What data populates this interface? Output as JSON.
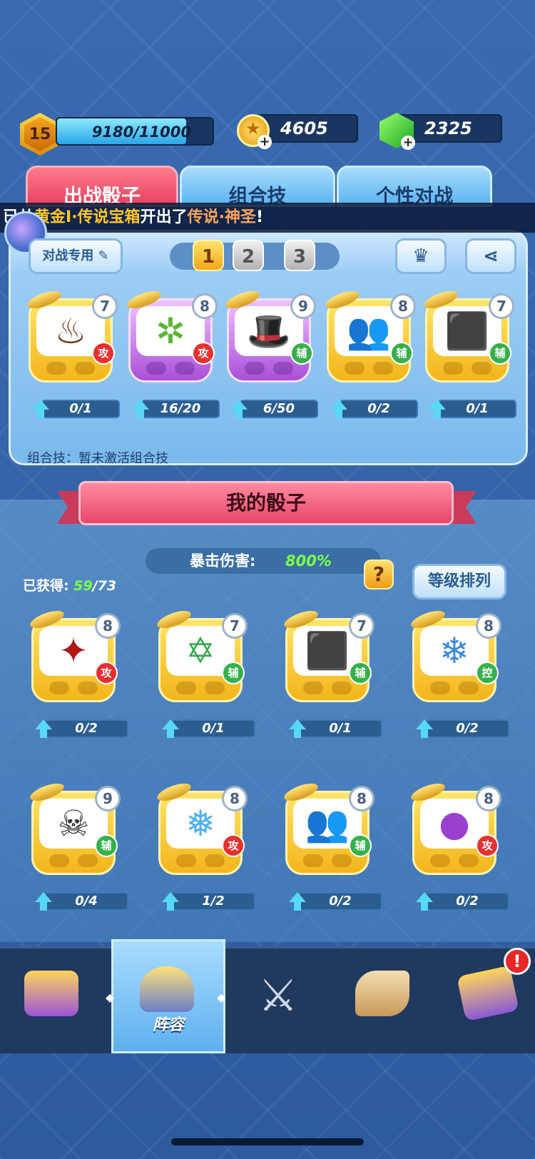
{
  "header": {
    "level": "15",
    "xp": "9180/11000",
    "xp_fraction": 0.83,
    "coins": "4605",
    "gems": "2325"
  },
  "tabs": [
    {
      "label": "出战骰子",
      "active": true
    },
    {
      "label": "组合技",
      "active": false
    },
    {
      "label": "个性对战",
      "active": false
    }
  ],
  "ticker": {
    "part1": "已从",
    "part2": "黄金I·传说宝箱",
    "part3": "开出了",
    "part4": "传说·神圣",
    "part5": "!"
  },
  "deck": {
    "name_label": "对战专用",
    "pages": [
      "1",
      "2",
      "3"
    ],
    "active_page": "1",
    "dice": [
      {
        "level": "7",
        "role": "攻",
        "progress": "0/1",
        "icon": "spiky-hair-icon",
        "style": "gold"
      },
      {
        "level": "8",
        "role": "攻",
        "progress": "16/20",
        "icon": "thorn-bush-icon",
        "style": "purple"
      },
      {
        "level": "9",
        "role": "辅",
        "progress": "6/50",
        "icon": "magic-hat-icon",
        "style": "purple"
      },
      {
        "level": "8",
        "role": "辅",
        "progress": "0/2",
        "icon": "twin-silhouette-icon",
        "style": "gold"
      },
      {
        "level": "7",
        "role": "辅",
        "progress": "0/1",
        "icon": "red-cylinder-icon",
        "style": "gold"
      }
    ],
    "combo_text": "组合技：暂未激活组合技"
  },
  "my_dice": {
    "title": "我的骰子",
    "obtained_label": "已获得:",
    "obtained_count": "59",
    "obtained_total": "/73",
    "crit_label": "暴击伤害:",
    "crit_value": "800%",
    "help_label": "?",
    "sort_label": "等级排列",
    "dice": [
      {
        "level": "8",
        "role": "攻",
        "progress": "0/2",
        "icon": "bloody-shuriken-icon"
      },
      {
        "level": "7",
        "role": "辅",
        "progress": "0/1",
        "icon": "magic-circle-icon"
      },
      {
        "level": "7",
        "role": "辅",
        "progress": "0/1",
        "icon": "red-cylinder-icon"
      },
      {
        "level": "8",
        "role": "控",
        "progress": "0/2",
        "icon": "snowflake-icon"
      },
      {
        "level": "9",
        "role": "辅",
        "progress": "0/4",
        "icon": "skull-icon"
      },
      {
        "level": "8",
        "role": "攻",
        "progress": "1/2",
        "icon": "ice-spirit-icon"
      },
      {
        "level": "8",
        "role": "辅",
        "progress": "0/2",
        "icon": "twin-silhouette-icon"
      },
      {
        "level": "8",
        "role": "攻",
        "progress": "0/2",
        "icon": "purple-bomb-icon"
      }
    ]
  },
  "nav": {
    "items": [
      {
        "icon": "treasure-chest-icon",
        "label": ""
      },
      {
        "icon": "cannon-icon",
        "label": "阵容",
        "active": true
      },
      {
        "icon": "crossed-swords-icon",
        "label": ""
      },
      {
        "icon": "scroll-quill-icon",
        "label": ""
      },
      {
        "icon": "book-icon",
        "label": ""
      }
    ],
    "alert": "!"
  },
  "colors": {
    "accent_pink": "#e7425e",
    "tab_blue": "#5cb3f0",
    "gold": "#f3b51b",
    "attack_red": "#e83030",
    "support_green": "#36b04a"
  }
}
